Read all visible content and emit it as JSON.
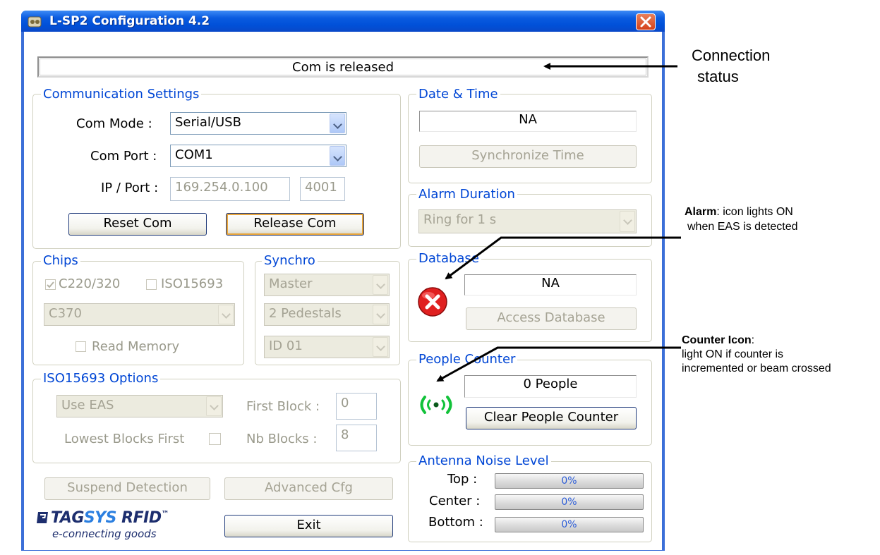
{
  "window": {
    "title": "L-SP2 Configuration 4.2"
  },
  "status": {
    "text": "Com is released"
  },
  "communication": {
    "title": "Communication Settings",
    "com_mode_label": "Com Mode :",
    "com_mode_value": "Serial/USB",
    "com_port_label": "Com Port :",
    "com_port_value": "COM1",
    "ip_port_label": "IP / Port :",
    "ip_value": "169.254.0.100",
    "port_value": "4001",
    "reset_label": "Reset Com",
    "release_label": "Release Com"
  },
  "chips": {
    "title": "Chips",
    "c220_label": "C220/320",
    "c220_checked": true,
    "iso_label": "ISO15693",
    "iso_checked": false,
    "chip_value": "C370",
    "read_memory_label": "Read Memory"
  },
  "synchro": {
    "title": "Synchro",
    "mode_value": "Master",
    "pedestals_value": "2 Pedestals",
    "id_value": "ID 01"
  },
  "iso_options": {
    "title": "ISO15693 Options",
    "eas_value": "Use EAS",
    "first_block_label": "First Block :",
    "first_block_value": "0",
    "lowest_label": "Lowest Blocks First",
    "nb_blocks_label": "Nb Blocks :",
    "nb_blocks_value": "8"
  },
  "bottom_buttons": {
    "suspend_label": "Suspend Detection",
    "advanced_label": "Advanced Cfg",
    "exit_label": "Exit"
  },
  "logo": {
    "brand1": "TAG",
    "brand2": "SYS",
    "brand3": " RFID",
    "tm": "™",
    "tagline": "e-connecting goods"
  },
  "date_time": {
    "title": "Date & Time",
    "value": "NA",
    "sync_label": "Synchronize Time"
  },
  "alarm": {
    "title": "Alarm Duration",
    "value": "Ring for 1 s"
  },
  "database": {
    "title": "Database",
    "value": "NA",
    "access_label": "Access Database"
  },
  "people": {
    "title": "People Counter",
    "value": "0 People",
    "clear_label": "Clear People Counter"
  },
  "noise": {
    "title": "Antenna Noise Level",
    "top_label": "Top :",
    "top_value": "0%",
    "center_label": "Center :",
    "center_value": "0%",
    "bottom_label": "Bottom :",
    "bottom_value": "0%"
  },
  "annotations": {
    "connection": "Connection",
    "status": "status",
    "alarm_bold": "Alarm",
    "alarm_rest": ": icon lights ON",
    "alarm_line2": "when EAS is detected",
    "counter_bold": "Counter Icon",
    "counter_colon": ":",
    "counter_line2": "light ON if counter  is",
    "counter_line3": "incremented or beam crossed"
  },
  "colors": {
    "group_label": "#0046d5",
    "title_bar": "#0a5be0",
    "alarm_red": "#e02020",
    "counter_green": "#12c23a"
  }
}
